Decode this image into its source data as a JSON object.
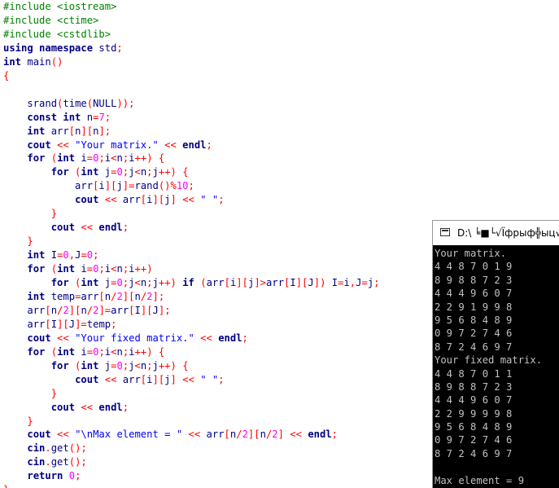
{
  "editor": {
    "lines": [
      [
        [
          "pp",
          "#include <iostream>"
        ]
      ],
      [
        [
          "pp",
          "#include <ctime>"
        ]
      ],
      [
        [
          "pp",
          "#include <cstdlib>"
        ]
      ],
      [
        [
          "kw",
          "using namespace"
        ],
        [
          "id",
          " std"
        ],
        [
          "op",
          ";"
        ]
      ],
      [
        [
          "kw",
          "int"
        ],
        [
          "id",
          " main"
        ],
        [
          "op",
          "()"
        ]
      ],
      [
        [
          "op",
          "{"
        ]
      ],
      [],
      [
        [
          "id",
          "    srand"
        ],
        [
          "op",
          "("
        ],
        [
          "id",
          "time"
        ],
        [
          "op",
          "("
        ],
        [
          "id",
          "NULL"
        ],
        [
          "op",
          "));"
        ]
      ],
      [
        [
          "id",
          "    "
        ],
        [
          "kw",
          "const int"
        ],
        [
          "id",
          " n"
        ],
        [
          "op",
          "="
        ],
        [
          "num",
          "7"
        ],
        [
          "op",
          ";"
        ]
      ],
      [
        [
          "id",
          "    "
        ],
        [
          "kw",
          "int"
        ],
        [
          "id",
          " arr"
        ],
        [
          "op",
          "["
        ],
        [
          "id",
          "n"
        ],
        [
          "op",
          "]["
        ],
        [
          "id",
          "n"
        ],
        [
          "op",
          "];"
        ]
      ],
      [
        [
          "id",
          "    "
        ],
        [
          "kw",
          "cout"
        ],
        [
          "op",
          " << "
        ],
        [
          "str",
          "\"Your matrix.\""
        ],
        [
          "op",
          " << "
        ],
        [
          "kw",
          "endl"
        ],
        [
          "op",
          ";"
        ]
      ],
      [
        [
          "id",
          "    "
        ],
        [
          "kw",
          "for"
        ],
        [
          "op",
          " ("
        ],
        [
          "kw",
          "int"
        ],
        [
          "id",
          " i"
        ],
        [
          "op",
          "="
        ],
        [
          "num",
          "0"
        ],
        [
          "op",
          ";"
        ],
        [
          "id",
          "i"
        ],
        [
          "op",
          "<"
        ],
        [
          "id",
          "n"
        ],
        [
          "op",
          ";"
        ],
        [
          "id",
          "i"
        ],
        [
          "op",
          "++) {"
        ]
      ],
      [
        [
          "id",
          "        "
        ],
        [
          "kw",
          "for"
        ],
        [
          "op",
          " ("
        ],
        [
          "kw",
          "int"
        ],
        [
          "id",
          " j"
        ],
        [
          "op",
          "="
        ],
        [
          "num",
          "0"
        ],
        [
          "op",
          ";"
        ],
        [
          "id",
          "j"
        ],
        [
          "op",
          "<"
        ],
        [
          "id",
          "n"
        ],
        [
          "op",
          ";"
        ],
        [
          "id",
          "j"
        ],
        [
          "op",
          "++) {"
        ]
      ],
      [
        [
          "id",
          "            arr"
        ],
        [
          "op",
          "["
        ],
        [
          "id",
          "i"
        ],
        [
          "op",
          "]["
        ],
        [
          "id",
          "j"
        ],
        [
          "op",
          "]="
        ],
        [
          "id",
          "rand"
        ],
        [
          "op",
          "()%"
        ],
        [
          "num",
          "10"
        ],
        [
          "op",
          ";"
        ]
      ],
      [
        [
          "id",
          "            "
        ],
        [
          "kw",
          "cout"
        ],
        [
          "op",
          " << "
        ],
        [
          "id",
          "arr"
        ],
        [
          "op",
          "["
        ],
        [
          "id",
          "i"
        ],
        [
          "op",
          "]["
        ],
        [
          "id",
          "j"
        ],
        [
          "op",
          "] << "
        ],
        [
          "str",
          "\" \""
        ],
        [
          "op",
          ";"
        ]
      ],
      [
        [
          "op",
          "        }"
        ]
      ],
      [
        [
          "id",
          "        "
        ],
        [
          "kw",
          "cout"
        ],
        [
          "op",
          " << "
        ],
        [
          "kw",
          "endl"
        ],
        [
          "op",
          ";"
        ]
      ],
      [
        [
          "op",
          "    }"
        ]
      ],
      [
        [
          "id",
          "    "
        ],
        [
          "kw",
          "int"
        ],
        [
          "id",
          " I"
        ],
        [
          "op",
          "="
        ],
        [
          "num",
          "0"
        ],
        [
          "op",
          ","
        ],
        [
          "id",
          "J"
        ],
        [
          "op",
          "="
        ],
        [
          "num",
          "0"
        ],
        [
          "op",
          ";"
        ]
      ],
      [
        [
          "id",
          "    "
        ],
        [
          "kw",
          "for"
        ],
        [
          "op",
          " ("
        ],
        [
          "kw",
          "int"
        ],
        [
          "id",
          " i"
        ],
        [
          "op",
          "="
        ],
        [
          "num",
          "0"
        ],
        [
          "op",
          ";"
        ],
        [
          "id",
          "i"
        ],
        [
          "op",
          "<"
        ],
        [
          "id",
          "n"
        ],
        [
          "op",
          ";"
        ],
        [
          "id",
          "i"
        ],
        [
          "op",
          "++)"
        ]
      ],
      [
        [
          "id",
          "        "
        ],
        [
          "kw",
          "for"
        ],
        [
          "op",
          " ("
        ],
        [
          "kw",
          "int"
        ],
        [
          "id",
          " j"
        ],
        [
          "op",
          "="
        ],
        [
          "num",
          "0"
        ],
        [
          "op",
          ";"
        ],
        [
          "id",
          "j"
        ],
        [
          "op",
          "<"
        ],
        [
          "id",
          "n"
        ],
        [
          "op",
          ";"
        ],
        [
          "id",
          "j"
        ],
        [
          "op",
          "++) "
        ],
        [
          "kw",
          "if"
        ],
        [
          "op",
          " ("
        ],
        [
          "id",
          "arr"
        ],
        [
          "op",
          "["
        ],
        [
          "id",
          "i"
        ],
        [
          "op",
          "]["
        ],
        [
          "id",
          "j"
        ],
        [
          "op",
          "]>"
        ],
        [
          "id",
          "arr"
        ],
        [
          "op",
          "["
        ],
        [
          "id",
          "I"
        ],
        [
          "op",
          "]["
        ],
        [
          "id",
          "J"
        ],
        [
          "op",
          "]) "
        ],
        [
          "id",
          "I"
        ],
        [
          "op",
          "="
        ],
        [
          "id",
          "i"
        ],
        [
          "op",
          ","
        ],
        [
          "id",
          "J"
        ],
        [
          "op",
          "="
        ],
        [
          "id",
          "j"
        ],
        [
          "op",
          ";"
        ]
      ],
      [
        [
          "id",
          "    "
        ],
        [
          "kw",
          "int"
        ],
        [
          "id",
          " temp"
        ],
        [
          "op",
          "="
        ],
        [
          "id",
          "arr"
        ],
        [
          "op",
          "["
        ],
        [
          "id",
          "n"
        ],
        [
          "op",
          "/"
        ],
        [
          "num",
          "2"
        ],
        [
          "op",
          "]["
        ],
        [
          "id",
          "n"
        ],
        [
          "op",
          "/"
        ],
        [
          "num",
          "2"
        ],
        [
          "op",
          "];"
        ]
      ],
      [
        [
          "id",
          "    arr"
        ],
        [
          "op",
          "["
        ],
        [
          "id",
          "n"
        ],
        [
          "op",
          "/"
        ],
        [
          "num",
          "2"
        ],
        [
          "op",
          "]["
        ],
        [
          "id",
          "n"
        ],
        [
          "op",
          "/"
        ],
        [
          "num",
          "2"
        ],
        [
          "op",
          "]="
        ],
        [
          "id",
          "arr"
        ],
        [
          "op",
          "["
        ],
        [
          "id",
          "I"
        ],
        [
          "op",
          "]["
        ],
        [
          "id",
          "J"
        ],
        [
          "op",
          "];"
        ]
      ],
      [
        [
          "id",
          "    arr"
        ],
        [
          "op",
          "["
        ],
        [
          "id",
          "I"
        ],
        [
          "op",
          "]["
        ],
        [
          "id",
          "J"
        ],
        [
          "op",
          "]="
        ],
        [
          "id",
          "temp"
        ],
        [
          "op",
          ";"
        ]
      ],
      [
        [
          "id",
          "    "
        ],
        [
          "kw",
          "cout"
        ],
        [
          "op",
          " << "
        ],
        [
          "str",
          "\"Your fixed matrix.\""
        ],
        [
          "op",
          " << "
        ],
        [
          "kw",
          "endl"
        ],
        [
          "op",
          ";"
        ]
      ],
      [
        [
          "id",
          "    "
        ],
        [
          "kw",
          "for"
        ],
        [
          "op",
          " ("
        ],
        [
          "kw",
          "int"
        ],
        [
          "id",
          " i"
        ],
        [
          "op",
          "="
        ],
        [
          "num",
          "0"
        ],
        [
          "op",
          ";"
        ],
        [
          "id",
          "i"
        ],
        [
          "op",
          "<"
        ],
        [
          "id",
          "n"
        ],
        [
          "op",
          ";"
        ],
        [
          "id",
          "i"
        ],
        [
          "op",
          "++) {"
        ]
      ],
      [
        [
          "id",
          "        "
        ],
        [
          "kw",
          "for"
        ],
        [
          "op",
          " ("
        ],
        [
          "kw",
          "int"
        ],
        [
          "id",
          " j"
        ],
        [
          "op",
          "="
        ],
        [
          "num",
          "0"
        ],
        [
          "op",
          ";"
        ],
        [
          "id",
          "j"
        ],
        [
          "op",
          "<"
        ],
        [
          "id",
          "n"
        ],
        [
          "op",
          ";"
        ],
        [
          "id",
          "j"
        ],
        [
          "op",
          "++) {"
        ]
      ],
      [
        [
          "id",
          "            "
        ],
        [
          "kw",
          "cout"
        ],
        [
          "op",
          " << "
        ],
        [
          "id",
          "arr"
        ],
        [
          "op",
          "["
        ],
        [
          "id",
          "i"
        ],
        [
          "op",
          "]["
        ],
        [
          "id",
          "j"
        ],
        [
          "op",
          "] << "
        ],
        [
          "str",
          "\" \""
        ],
        [
          "op",
          ";"
        ]
      ],
      [
        [
          "op",
          "        }"
        ]
      ],
      [
        [
          "id",
          "        "
        ],
        [
          "kw",
          "cout"
        ],
        [
          "op",
          " << "
        ],
        [
          "kw",
          "endl"
        ],
        [
          "op",
          ";"
        ]
      ],
      [
        [
          "op",
          "    }"
        ]
      ],
      [
        [
          "id",
          "    "
        ],
        [
          "kw",
          "cout"
        ],
        [
          "op",
          " << "
        ],
        [
          "str",
          "\"\\nMax element = \""
        ],
        [
          "op",
          " << "
        ],
        [
          "id",
          "arr"
        ],
        [
          "op",
          "["
        ],
        [
          "id",
          "n"
        ],
        [
          "op",
          "/"
        ],
        [
          "num",
          "2"
        ],
        [
          "op",
          "]["
        ],
        [
          "id",
          "n"
        ],
        [
          "op",
          "/"
        ],
        [
          "num",
          "2"
        ],
        [
          "op",
          "] << "
        ],
        [
          "kw",
          "endl"
        ],
        [
          "op",
          ";"
        ]
      ],
      [
        [
          "id",
          "    "
        ],
        [
          "kw",
          "cin"
        ],
        [
          "op",
          "."
        ],
        [
          "id",
          "get"
        ],
        [
          "op",
          "();"
        ]
      ],
      [
        [
          "id",
          "    "
        ],
        [
          "kw",
          "cin"
        ],
        [
          "op",
          "."
        ],
        [
          "id",
          "get"
        ],
        [
          "op",
          "();"
        ]
      ],
      [
        [
          "id",
          "    "
        ],
        [
          "kw",
          "return"
        ],
        [
          "id",
          " "
        ],
        [
          "num",
          "0"
        ],
        [
          "op",
          ";"
        ]
      ],
      [
        [
          "op",
          "}"
        ]
      ]
    ]
  },
  "console": {
    "title": "D:\\ ╘■└√Їфрыф╬ыц√ры",
    "output": [
      "Your matrix.",
      "4 4 8 7 0 1 9",
      "8 9 8 8 7 2 3",
      "4 4 4 9 6 0 7",
      "2 2 9 1 9 9 8",
      "9 5 6 8 4 8 9",
      "0 9 7 2 7 4 6",
      "8 7 2 4 6 9 7",
      "Your fixed matrix.",
      "4 4 8 7 0 1 1",
      "8 9 8 8 7 2 3",
      "4 4 4 9 6 0 7",
      "2 2 9 9 9 9 8",
      "9 5 6 8 4 8 9",
      "0 9 7 2 7 4 6",
      "8 7 2 4 6 9 7",
      "",
      "Max element = 9"
    ]
  }
}
